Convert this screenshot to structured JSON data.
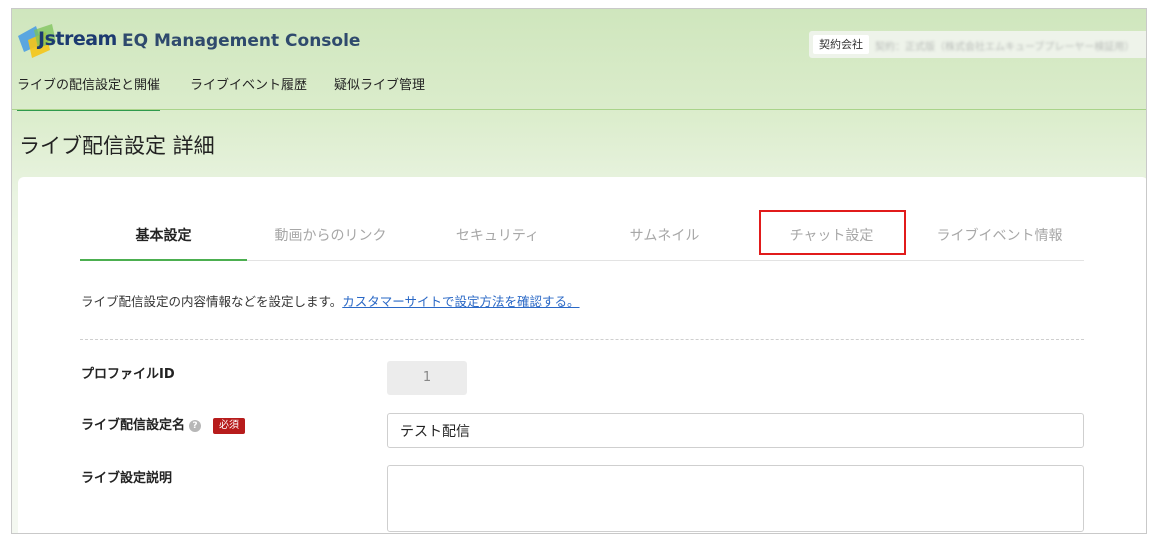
{
  "header": {
    "logo_text": "Jstream",
    "app_title": "EQ Management Console",
    "contract_label": "契約会社",
    "contract_value": "契約：正式版（株式会社エムキューブプレーヤー検証用）"
  },
  "topnav": {
    "items": [
      {
        "label": "ライブの配信設定と開催",
        "active": true
      },
      {
        "label": "ライブイベント履歴",
        "active": false
      },
      {
        "label": "疑似ライブ管理",
        "active": false
      }
    ]
  },
  "page_title": "ライブ配信設定 詳細",
  "tabs": [
    {
      "label": "基本設定",
      "active": true
    },
    {
      "label": "動画からのリンク",
      "active": false
    },
    {
      "label": "セキュリティ",
      "active": false
    },
    {
      "label": "サムネイル",
      "active": false
    },
    {
      "label": "チャット設定",
      "active": false,
      "highlighted": true
    },
    {
      "label": "ライブイベント情報",
      "active": false
    }
  ],
  "description": {
    "text": "ライブ配信設定の内容情報などを設定します。",
    "link": "カスタマーサイトで設定方法を確認する。"
  },
  "form": {
    "profile_id_label": "プロファイルID",
    "profile_id_value": "1",
    "name_label": "ライブ配信設定名",
    "help_icon_glyph": "?",
    "required_badge": "必須",
    "name_value": "テスト配信",
    "desc_label": "ライブ設定説明",
    "desc_value": ""
  },
  "colors": {
    "accent_green": "#4caf50",
    "highlight_red": "#e11b1b",
    "required_red": "#b71c1c",
    "link_blue": "#2a68c6"
  }
}
